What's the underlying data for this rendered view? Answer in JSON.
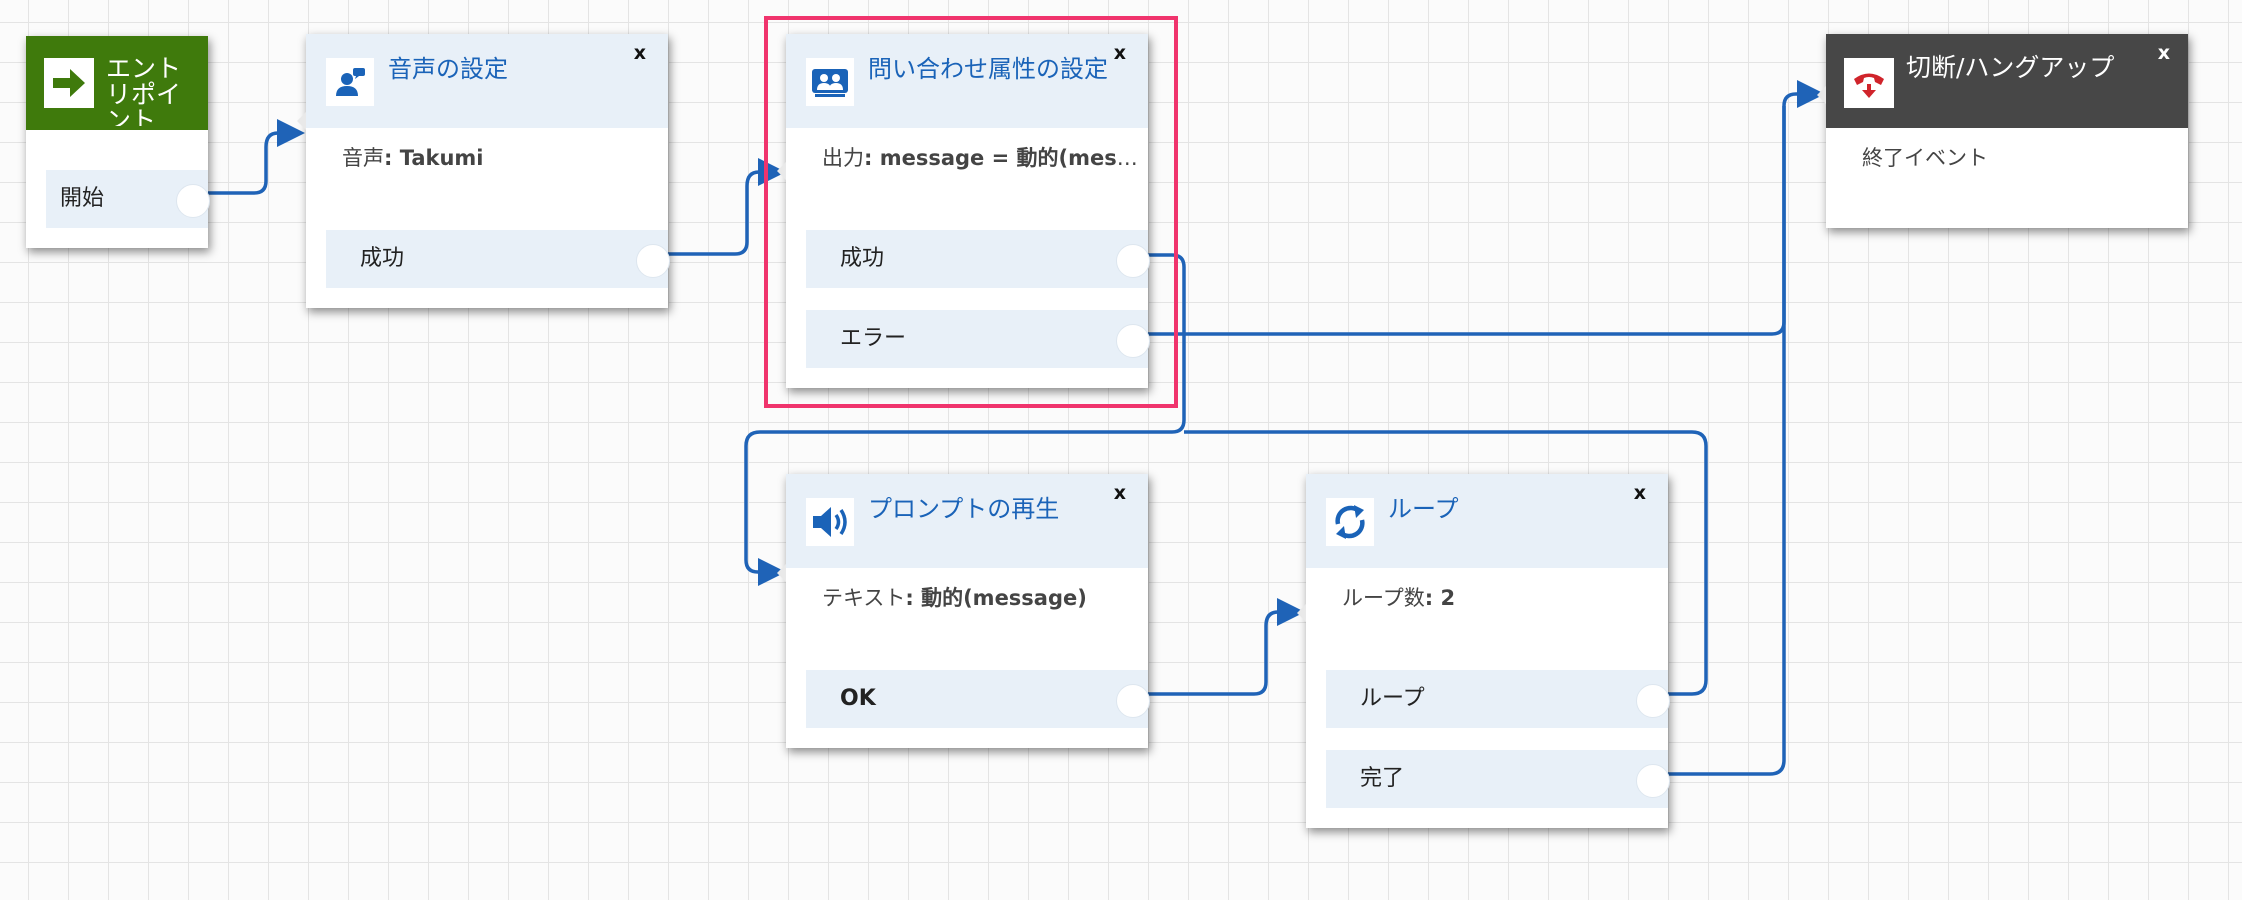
{
  "blocks": {
    "entry": {
      "title": "エントリポイント",
      "port_start": "開始"
    },
    "set_voice": {
      "title": "音声の設定",
      "close": "x",
      "detail_label": "音声",
      "detail_value": ": Takumi",
      "port_success": "成功"
    },
    "set_attributes": {
      "title": "問い合わせ属性の設定",
      "close": "x",
      "detail_label": "出力",
      "detail_value": ": message = 動的(mess...",
      "port_success": "成功",
      "port_error": "エラー"
    },
    "disconnect": {
      "title": "切断/ハングアップ",
      "close": "x",
      "detail": "終了イベント"
    },
    "play_prompt": {
      "title": "プロンプトの再生",
      "close": "x",
      "detail_label": "テキスト",
      "detail_value": ": 動的(message)",
      "port_ok": "OK"
    },
    "loop": {
      "title": "ループ",
      "close": "x",
      "detail_label": "ループ数",
      "detail_value": ": 2",
      "port_loop": "ループ",
      "port_complete": "完了"
    }
  },
  "colors": {
    "connector": "#1f63b7",
    "selection": "#f0346d",
    "entry_header": "#3f7a0c",
    "disconnect_header": "#474747",
    "block_header": "#e8f0f8",
    "title_text": "#1a63b8"
  },
  "icons": {
    "entry": "arrow-right-icon",
    "set_voice": "voice-person-icon",
    "set_attributes": "contact-attributes-icon",
    "disconnect": "phone-hangup-icon",
    "play_prompt": "speaker-icon",
    "loop": "loop-arrows-icon"
  }
}
